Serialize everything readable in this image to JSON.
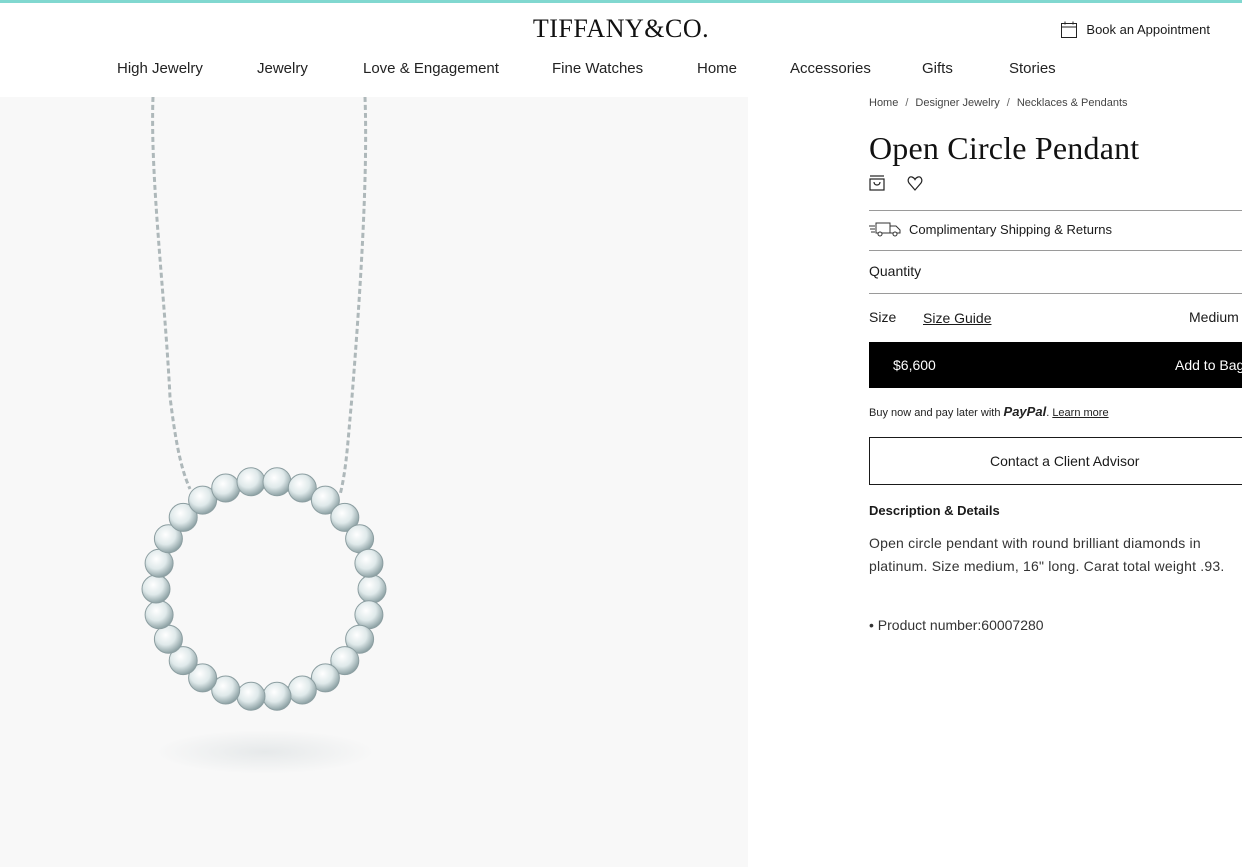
{
  "header": {
    "logo": "TIFFANY&CO.",
    "appointment_label": "Book an Appointment",
    "brand_color": "#81d8d0"
  },
  "nav": {
    "items": [
      "High Jewelry",
      "Jewelry",
      "Love & Engagement",
      "Fine Watches",
      "Home",
      "Accessories",
      "Gifts",
      "Stories"
    ]
  },
  "breadcrumb": [
    "Home",
    "Designer Jewelry",
    "Necklaces & Pendants"
  ],
  "product": {
    "title": "Open Circle Pendant",
    "shipping": "Complimentary Shipping & Returns",
    "quantity_label": "Quantity",
    "size_label": "Size",
    "size_guide": "Size Guide",
    "size_value": "Medium",
    "price": "$6,600",
    "add_to_bag": "Add to Bag",
    "paypal": {
      "prefix": "Buy now and pay later with",
      "brand": "PayPal",
      "learn_more": "Learn more"
    },
    "advisor_button": "Contact a Client Advisor",
    "description_heading": "Description & Details",
    "description": "Open circle pendant with round brilliant diamonds in platinum. Size medium, 16\" long. Carat total weight .93.",
    "product_number": "• Product number:60007280"
  },
  "icons": {
    "appointment": "calendar-icon",
    "bag_outline": "shopping-bag-icon",
    "heart_outline": "heart-icon",
    "shipping": "delivery-truck-icon"
  }
}
